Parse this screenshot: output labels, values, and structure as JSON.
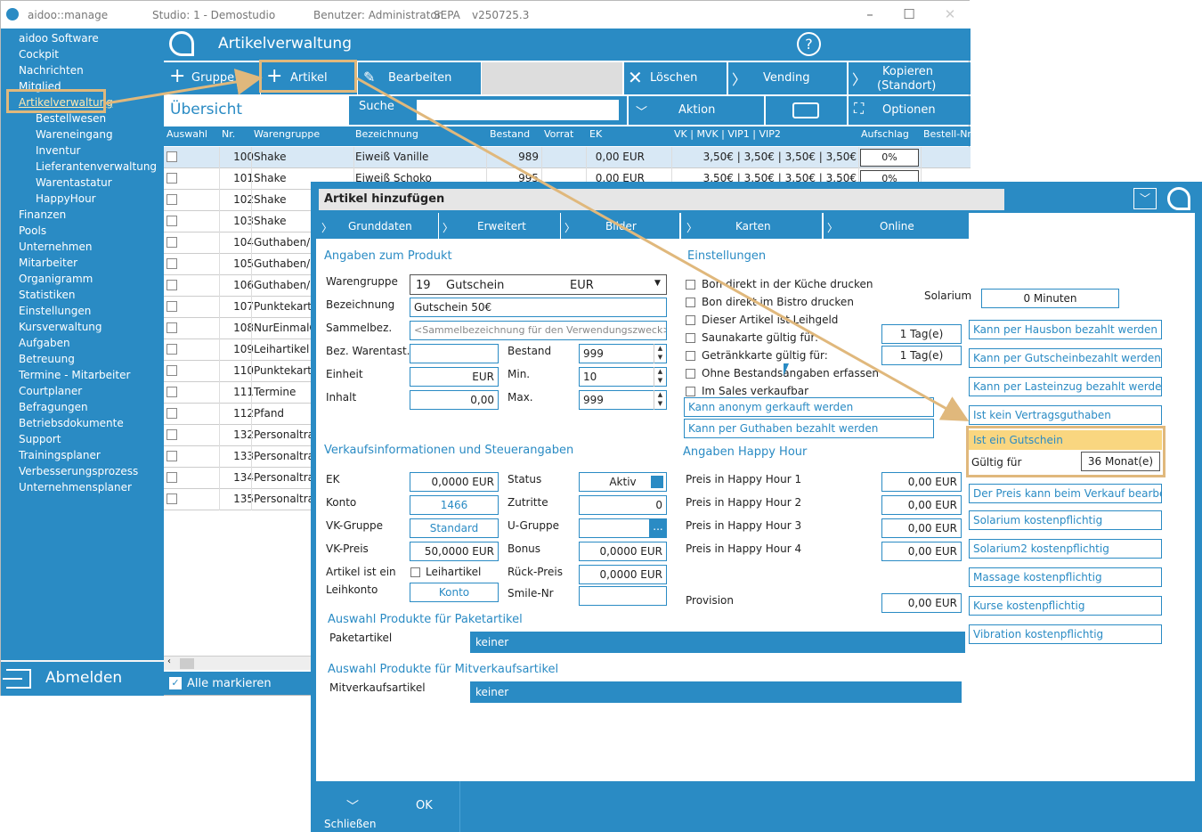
{
  "window": {
    "app": "aidoo::manage",
    "studio": "Studio: 1 - Demostudio",
    "user": "Benutzer: Administrator",
    "sepa": "SEPA",
    "version": "v250725.3"
  },
  "sidebar": {
    "items": [
      "aidoo Software",
      "Cockpit",
      "Nachrichten",
      "Mitglied",
      "Artikelverwaltung",
      "Bestellwesen",
      "Wareneingang",
      "Inventur",
      "Lieferantenverwaltung",
      "Warentastatur",
      "HappyHour",
      "Finanzen",
      "Pools",
      "Unternehmen",
      "Mitarbeiter",
      "Organigramm",
      "Statistiken",
      "Einstellungen",
      "Kursverwaltung",
      "Aufgaben",
      "Betreuung",
      "Termine - Mitarbeiter",
      "Courtplaner",
      "Befragungen",
      "Betriebsdokumente",
      "Support",
      "Trainingsplaner",
      "Verbesserungsprozess",
      "Unternehmensplaner"
    ],
    "logout": "Abmelden"
  },
  "header": {
    "title": "Artikelverwaltung",
    "help": "?"
  },
  "toolbar": {
    "gruppe": "Gruppe",
    "artikel": "Artikel",
    "bearbeiten": "Bearbeiten",
    "loeschen": "Löschen",
    "vending": "Vending",
    "kopieren1": "Kopieren",
    "kopieren2": "(Standort)"
  },
  "toolbar2": {
    "uebersicht": "Übersicht",
    "suche": "Suche",
    "aktion": "Aktion",
    "optionen": "Optionen"
  },
  "table": {
    "headers": [
      "Auswahl",
      "Nr.",
      "Warengruppe",
      "Bezeichnung",
      "Bestand",
      "Vorrat",
      "EK",
      "VK | MVK | VIP1 | VIP2",
      "Aufschlag",
      "Bestell-Nr"
    ],
    "rows": [
      [
        "100",
        "Shake",
        "Eiweiß Vanille",
        "989",
        "0,00 EUR",
        "3,50€ | 3,50€ | 3,50€ | 3,50€",
        "0%"
      ],
      [
        "101",
        "Shake",
        "Eiweiß Schoko",
        "995",
        "0,00 EUR",
        "3,50€ | 3,50€ | 3,50€ | 3,50€",
        "0%"
      ],
      [
        "102",
        "Shake"
      ],
      [
        "103",
        "Shake"
      ],
      [
        "104",
        "Guthaben/E"
      ],
      [
        "105",
        "Guthaben/E"
      ],
      [
        "106",
        "Guthaben/E"
      ],
      [
        "107",
        "Punktekarte"
      ],
      [
        "108",
        "NurEinmalG"
      ],
      [
        "109",
        "Leihartikel"
      ],
      [
        "110",
        "Punktekarte"
      ],
      [
        "111",
        "Termine"
      ],
      [
        "112",
        "Pfand"
      ],
      [
        "132",
        "Personaltra"
      ],
      [
        "133",
        "Personaltra"
      ],
      [
        "134",
        "Personaltra"
      ],
      [
        "135",
        "Personaltra"
      ]
    ],
    "select_all": "Alle markieren"
  },
  "dialog": {
    "title": "Artikel hinzufügen",
    "tabs": [
      "Grunddaten",
      "Erweitert",
      "Bilder",
      "Karten",
      "Online"
    ],
    "produkt": {
      "heading": "Angaben zum Produkt",
      "warengruppe_label": "Warengruppe",
      "warengruppe_nr": "19",
      "warengruppe_name": "Gutschein",
      "warengruppe_cur": "EUR",
      "bezeichnung_label": "Bezeichnung",
      "bezeichnung": "Gutschein 50€",
      "sammelbez_label": "Sammelbez.",
      "sammelbez_placeholder": "<Sammelbezeichnung für den Verwendungszweck>",
      "bezwarentast_label": "Bez. Warentast.",
      "bestand_label": "Bestand",
      "bestand": "999",
      "einheit_label": "Einheit",
      "einheit": "EUR",
      "min_label": "Min.",
      "min": "10",
      "inhalt_label": "Inhalt",
      "inhalt": "0,00",
      "max_label": "Max.",
      "max": "999"
    },
    "verkauf": {
      "heading": "Verkaufsinformationen und Steuerangaben",
      "ek_label": "EK",
      "ek": "0,0000 EUR",
      "status_label": "Status",
      "status": "Aktiv",
      "konto_label": "Konto",
      "konto": "1466",
      "zutritte_label": "Zutritte",
      "zutritte": "0",
      "vkgruppe_label": "VK-Gruppe",
      "vkgruppe": "Standard",
      "ugruppe_label": "U-Gruppe",
      "ugruppe_btn": "...",
      "vkpreis_label": "VK-Preis",
      "vkpreis": "50,0000 EUR",
      "bonus_label": "Bonus",
      "bonus": "0,0000 EUR",
      "leih_label1": "Artikel ist ein",
      "leih_label2": "Leihkonto",
      "leihartikel": "Leihartikel",
      "rueckpreis_label": "Rück-Preis",
      "rueckpreis": "0,0000 EUR",
      "leihkonto": "Konto",
      "smile_label": "Smile-Nr"
    },
    "paket": {
      "heading": "Auswahl Produkte für Paketartikel",
      "label": "Paketartikel",
      "value": "keiner"
    },
    "mitverkauf": {
      "heading": "Auswahl Produkte für Mitverkaufsartikel",
      "label": "Mitverkaufsartikel",
      "value": "keiner"
    },
    "einstellungen": {
      "heading": "Einstellungen",
      "checks": [
        "Bon direkt in der Küche drucken",
        "Bon direkt im Bistro drucken",
        "Dieser Artikel ist Leihgeld",
        "Saunakarte gültig für:",
        "Getränkkarte gültig für:",
        "Ohne Bestandsangaben erfassen",
        "Im Sales verkaufbar"
      ],
      "solarium_label": "Solarium",
      "solarium": "0 Minuten",
      "sauna_days": "1 Tag(e)",
      "getraenk_days": "1 Tag(e)",
      "anonym": "Kann anonym gerkauft werden",
      "guthaben": "Kann per Guthaben bezahlt werden"
    },
    "happyhour": {
      "heading": "Angaben Happy Hour",
      "labels": [
        "Preis in Happy Hour 1",
        "Preis in Happy Hour 2",
        "Preis in Happy Hour 3",
        "Preis in Happy Hour 4"
      ],
      "values": [
        "0,00 EUR",
        "0,00 EUR",
        "0,00 EUR",
        "0,00 EUR"
      ],
      "provision_label": "Provision",
      "provision": "0,00 EUR"
    },
    "options": {
      "hausbon": "Kann per Hausbon bezahlt werden",
      "gutscheinbezahlt": "Kann per Gutscheinbezahlt werden",
      "lasteinzug": "Kann per Lasteinzug bezahlt werden",
      "vertragsguthaben": "Ist kein Vertragsguthaben",
      "gutschein": "Ist ein Gutschein",
      "gueltig_label": "Gültig für",
      "gueltig": "36 Monat(e)",
      "preisverkauf": "Der Preis kann beim Verkauf bearbeiten",
      "solarium": "Solarium kostenpflichtig",
      "solarium2": "Solarium2 kostenpflichtig",
      "massage": "Massage kostenpflichtig",
      "kurse": "Kurse kostenpflichtig",
      "vibration": "Vibration kostenpflichtig"
    },
    "footer": {
      "close": "Schließen",
      "ok": "OK"
    }
  },
  "colors": {
    "accent": "#2a8bc4",
    "highlight": "#e0b87c"
  }
}
